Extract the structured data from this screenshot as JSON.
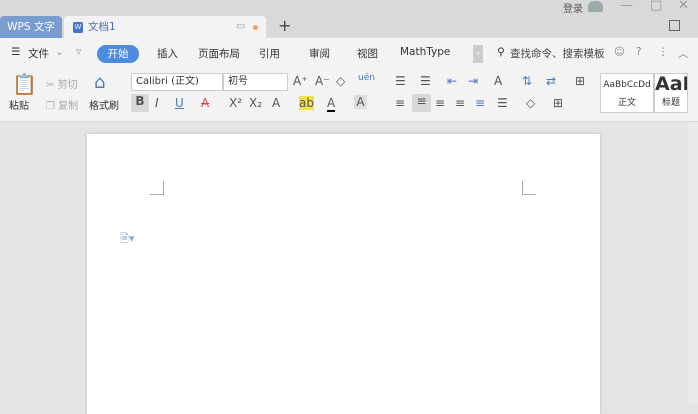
{
  "titlebar": {
    "app_tab": "WPS 文字",
    "doc_tab": "文档1",
    "doc_icon": "W",
    "new_tab": "+",
    "login": "登录",
    "minimize": "—",
    "maximize": "□",
    "close": "✕"
  },
  "menu": {
    "file": "文件",
    "tabs": [
      "开始",
      "插入",
      "页面布局",
      "引用",
      "审阅",
      "视图",
      "MathType"
    ],
    "search": "查找命令、搜索模板"
  },
  "toolbar": {
    "paste": "粘贴",
    "cut": "剪切",
    "copy": "复制",
    "format_painter": "格式刷",
    "font": "Calibri (正文)",
    "size": "初号",
    "phonetic": "uén",
    "styles": [
      {
        "preview": "AaBbCcDd",
        "name": "正文"
      },
      {
        "preview": "AaB",
        "name": "标题"
      }
    ]
  }
}
